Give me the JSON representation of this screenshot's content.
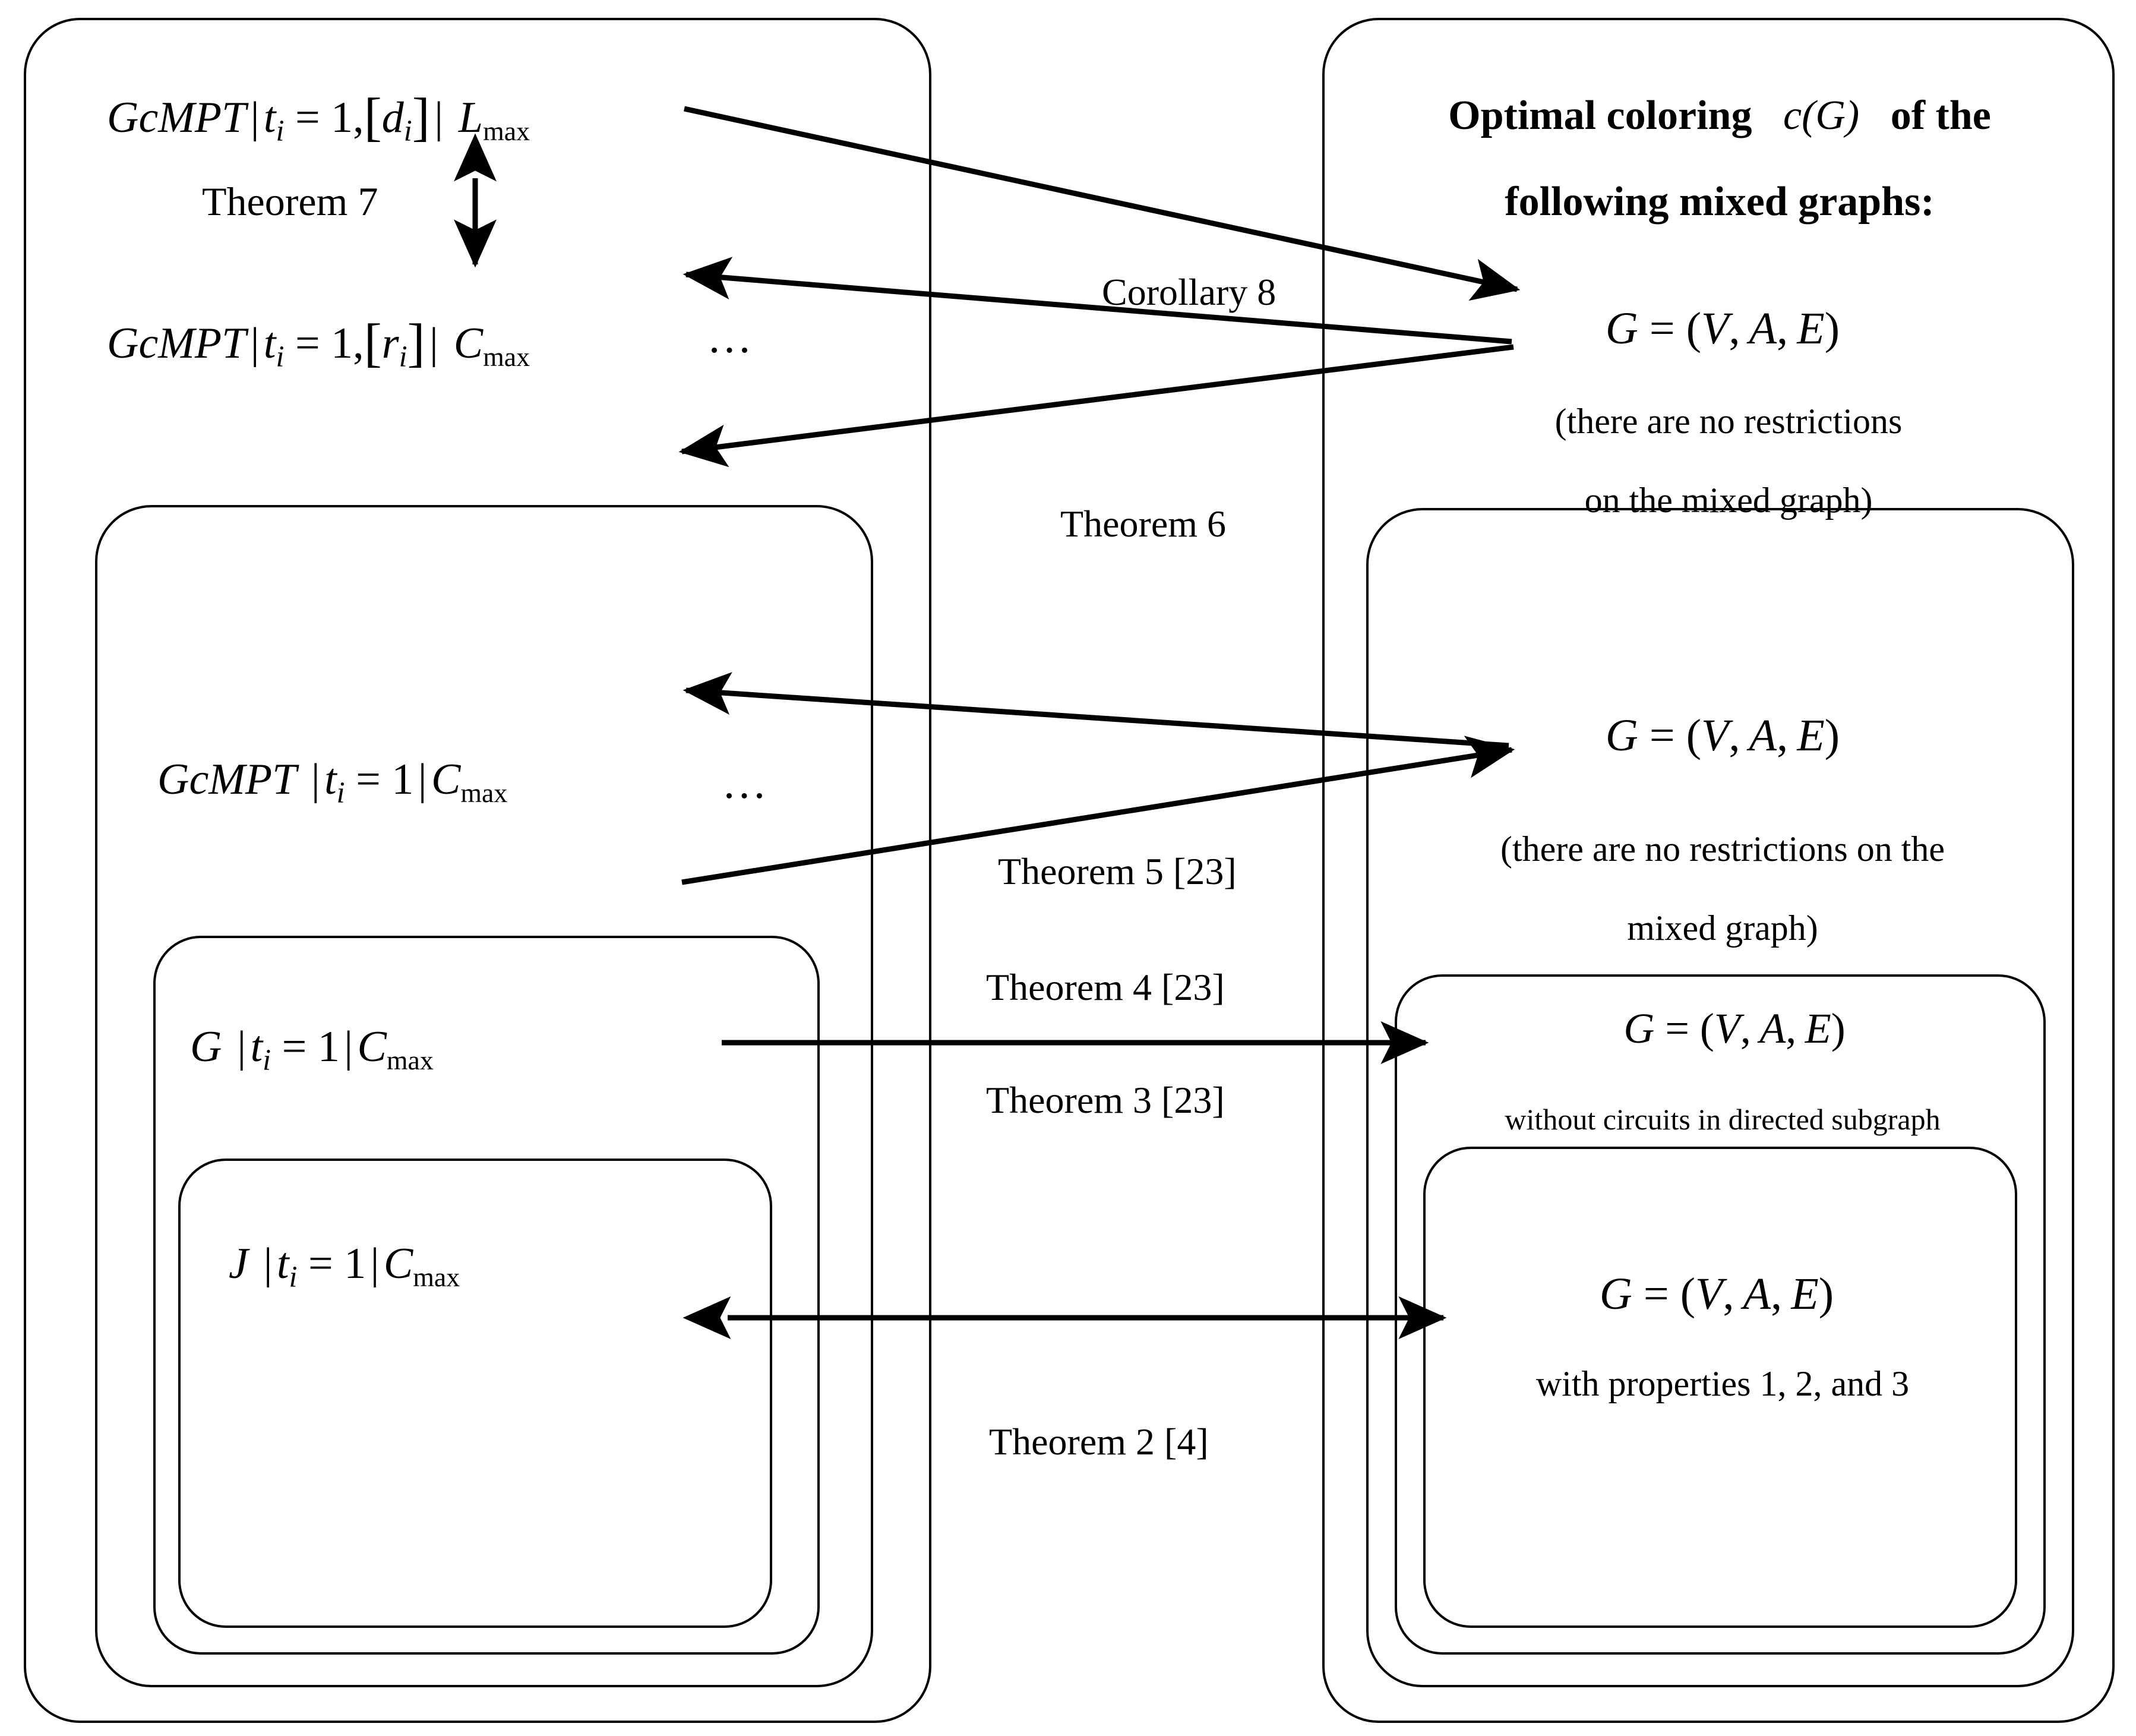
{
  "diagram": {
    "title_right": {
      "line1_pre": "Optimal coloring",
      "line1_math": "c(G)",
      "line1_post": "of the",
      "line2": "following mixed graphs:"
    },
    "left_column": {
      "outer_box": {
        "name": "scheduling-problems-outer",
        "items": [
          {
            "id": "gcmpt-di-lmax",
            "text": "GcMPT | t_i = 1, [d_i] | L_max"
          },
          {
            "id": "gcmpt-ri-cmax",
            "text": "GcMPT | t_i = 1, [r_i] | C_max"
          }
        ],
        "theorem_vertical": "Theorem 7",
        "ellipsis": "…"
      },
      "level2_box": {
        "name": "gcmpt-cmax-box",
        "item": "GcMPT | t_i = 1 | C_max",
        "ellipsis": "…"
      },
      "level3_box": {
        "name": "g-cmax-box",
        "item": "G | t_i = 1 | C_max"
      },
      "level4_box": {
        "name": "j-cmax-box",
        "item": "J | t_i = 1 | C_max"
      }
    },
    "right_column": {
      "outer_box": {
        "name": "mixed-graph-outer",
        "item": "G = (V, A, E)",
        "note_line1": "(there are no restrictions",
        "note_line2": "on the mixed graph)"
      },
      "level2_box": {
        "name": "mixed-graph-level2",
        "item": "G = (V, A, E)",
        "note_line1": "(there are no restrictions on the",
        "note_line2": "mixed graph)"
      },
      "level3_box": {
        "name": "mixed-graph-no-circuits",
        "item": "G = (V, A, E)",
        "note": "without circuits in directed subgraph"
      },
      "level4_box": {
        "name": "mixed-graph-properties",
        "item": "G = (V, A, E)",
        "note": "with properties 1, 2, and 3"
      }
    },
    "connector_labels": [
      {
        "id": "corollary-8",
        "text": "Corollary 8"
      },
      {
        "id": "theorem-6",
        "text": "Theorem 6"
      },
      {
        "id": "theorem-5-23",
        "text": "Theorem 5 [23]"
      },
      {
        "id": "theorem-4-23",
        "text": "Theorem 4 [23]"
      },
      {
        "id": "theorem-3-23",
        "text": "Theorem 3 [23]"
      },
      {
        "id": "theorem-2-4",
        "text": "Theorem 2 [4]"
      }
    ],
    "colors": {
      "line": "#000000",
      "background": "#ffffff"
    }
  }
}
